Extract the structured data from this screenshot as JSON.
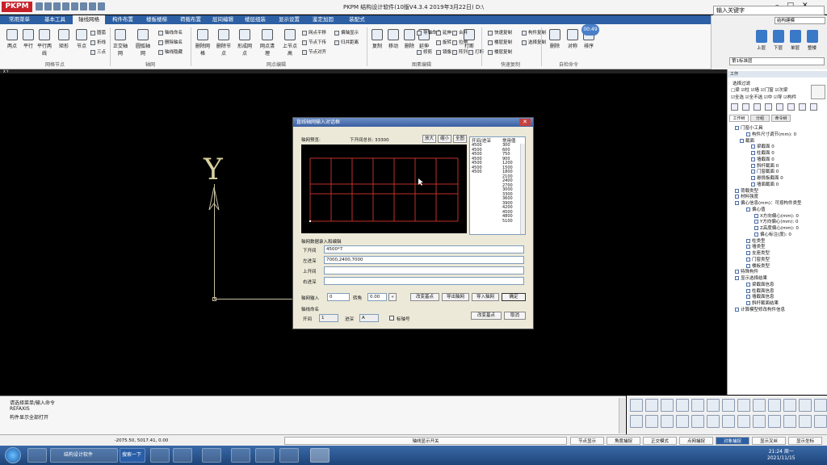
{
  "app": {
    "logo": "PKPM",
    "title": "PKPM 结构设计软件(10版V4.3.4 2019年3月22日) D:\\",
    "search_placeholder": "输入关键字"
  },
  "menu_tabs": [
    "常用菜单",
    "基本工具",
    "轴线网格",
    "构件布置",
    "楼板楼梯",
    "荷载布置",
    "层间编辑",
    "楼层组装",
    "显示设置",
    "鉴定加固",
    "装配式"
  ],
  "active_tab": "轴线网格",
  "ribbon": {
    "groups": [
      "网格节点",
      "轴网",
      "网点编辑",
      "图素编辑",
      "快速复制",
      "自检命令"
    ],
    "big_buttons": [
      "两点",
      "平行",
      "平行两线",
      "矩形",
      "节点",
      "正交轴网",
      "圆弧轴网",
      "删除网格",
      "删除节点",
      "形成网点",
      "网点清理",
      "上节点高",
      "复制",
      "移动",
      "删除",
      "延伸",
      "打断",
      "删除",
      "对称",
      "排序"
    ],
    "small_items": [
      "圆弧",
      "折线",
      "三点",
      "轴线命名",
      "删除轴名",
      "轴线隐藏",
      "网点平移",
      "节点下传",
      "节点对齐",
      "偏轴显示",
      "归并距离",
      "导轴命名",
      "延伸",
      "旋转",
      "镜像",
      "拉伸",
      "修剪",
      "阵列",
      "打断",
      "合并",
      "快速复制",
      "楼层复制",
      "构件复制",
      "选择复制",
      "楼层复制"
    ],
    "timer": "00:49"
  },
  "right_panel": {
    "combo": "结构建模",
    "buttons": [
      "上层",
      "下层",
      "单层",
      "整楼"
    ],
    "floor": "第1标准层"
  },
  "canvas": {
    "coord_title": "X Y",
    "axis_label": "Y"
  },
  "dialog": {
    "title": "直线轴网输入对话框",
    "preview_label": "轴网预览:",
    "total_span": "下开间总长: 33300",
    "zoom_buttons": [
      "放大",
      "缩小",
      "全图"
    ],
    "list_headers": [
      "开间/进深",
      "常用值"
    ],
    "left_values": [
      "4500",
      "4500",
      "4500",
      "4500",
      "4500",
      "4500",
      "4500"
    ],
    "common_values": [
      "300",
      "600",
      "750",
      "900",
      "1200",
      "1500",
      "1800",
      "2100",
      "2400",
      "2700",
      "3000",
      "3300",
      "3600",
      "3900",
      "4200",
      "4500",
      "4800",
      "5100"
    ],
    "section_label": "轴网数据录入和编辑",
    "fields": [
      {
        "label": "下开间",
        "value": "4500*7"
      },
      {
        "label": "左进深",
        "value": "7000,2400,7000"
      },
      {
        "label": "上开间",
        "value": ""
      },
      {
        "label": "右进深",
        "value": ""
      }
    ],
    "base_point_label": "轴网输入",
    "base_point_value": "0",
    "angle_label": "转角",
    "angle_value": "0.00",
    "action_buttons": [
      "改变基点",
      "导出轴网",
      "导入轴网",
      "确定"
    ],
    "name_section": "轴线命名",
    "name_start_label": "开间",
    "name_start_value": "1",
    "name_depth_label": "进深",
    "name_depth_value": "A",
    "checkbox_label": "标轴号",
    "bottom_buttons": [
      "改变基点",
      "取消"
    ]
  },
  "tree_panel": {
    "header": "工作",
    "filter_label": "选择过滤",
    "checkbox_rows": [
      "□梁 ☑柱 ☑墙 ☑门窗 ☑次梁",
      "☑全选 ☑全不选 ☑中 ☑导 ☑构件"
    ],
    "tabs": [
      "工作树",
      "分组",
      "命令树"
    ],
    "items": [
      "门窗小工具",
      "构件尺寸调节(mm): 0",
      "截面",
      "梁截面 0",
      "柱截面 0",
      "墙截面 0",
      "斜杆截面 0",
      "门窗截面 0",
      "悬挑板截面 0",
      "墙面截面 0",
      "荷载类型",
      "材料强度",
      "偏心信息(mm)：可按构件类型",
      "偏心值",
      "X方向偏心(mm): 0",
      "Y方向偏心(mm): 0",
      "Z高度偏心(mm): 0",
      "偏心标注(度): 0",
      "柱类型",
      "墙类型",
      "支座类型",
      "门窗类型",
      "楼板类型",
      "特殊构件",
      "显示选择结果",
      "梁截面信息",
      "柱截面信息",
      "墙截面信息",
      "斜杆截面结果",
      "计算模型修改构件信息"
    ]
  },
  "command": {
    "lines": [
      "请选择菜单/输入命令",
      "REFAXIS",
      "构件显示全部打开"
    ]
  },
  "bottom_bar": {
    "coords": "-2075.50, 5017.41, 0.00",
    "center": "轴线显示开关",
    "toggles": [
      "节点显示",
      "角度捕捉",
      "正交模式",
      "点网捕捉",
      "对象捕捉",
      "显示叉丝",
      "显示坐标"
    ],
    "active_toggle": "对象捕捉"
  },
  "taskbar": {
    "item1": "结构设计软件",
    "item2": "搜索一下",
    "time": "21:24 周一",
    "date": "2021/11/15"
  }
}
